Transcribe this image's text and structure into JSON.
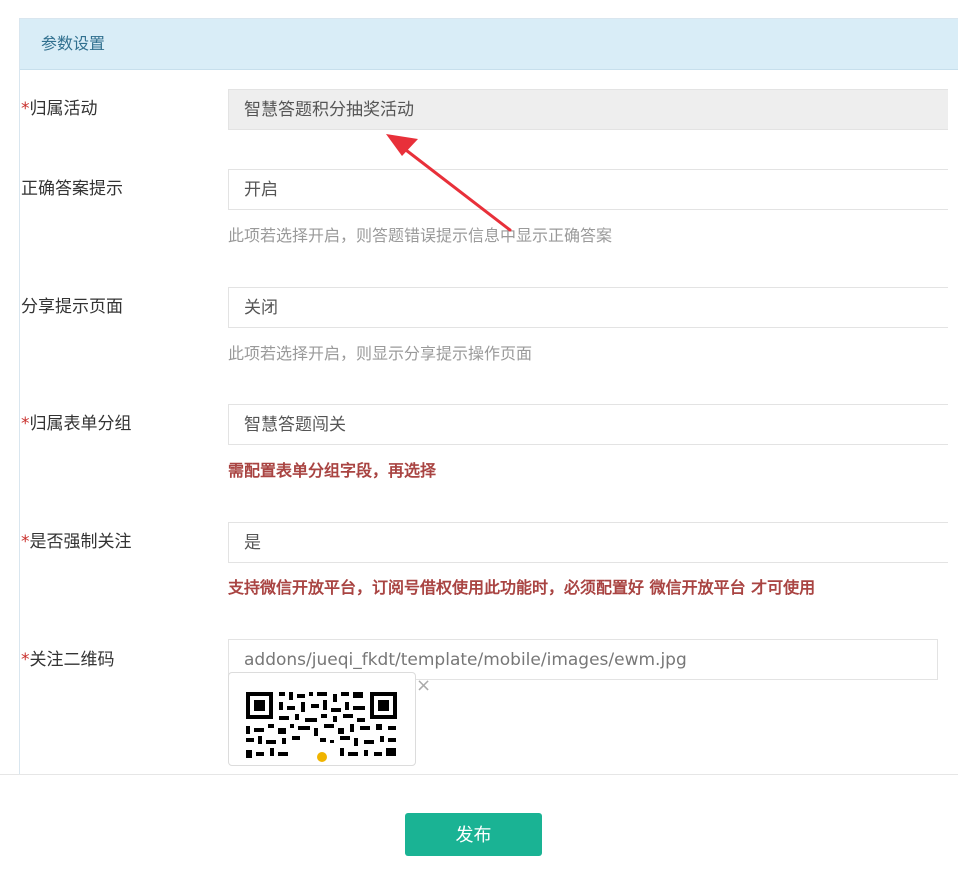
{
  "panel": {
    "heading": "参数设置"
  },
  "form": {
    "required_mark": "*",
    "activity": {
      "label": "归属活动",
      "value": "智慧答题积分抽奖活动"
    },
    "show_answer": {
      "label": "正确答案提示",
      "value": "开启",
      "help": "此项若选择开启，则答题错误提示信息中显示正确答案"
    },
    "share_page": {
      "label": "分享提示页面",
      "value": "关闭",
      "help": "此项若选择开启，则显示分享提示操作页面"
    },
    "form_group": {
      "label": "归属表单分组",
      "value": "智慧答题闯关",
      "warning": "需配置表单分组字段，再选择"
    },
    "force_follow": {
      "label": "是否强制关注",
      "value": "是",
      "warning": "支持微信开放平台，订阅号借权使用此功能时，必须配置好 微信开放平台 才可使用"
    },
    "qrcode": {
      "label": "关注二维码",
      "value": "addons/jueqi_fkdt/template/mobile/images/ewm.jpg",
      "remove_label": "×"
    }
  },
  "actions": {
    "publish_label": "发布"
  },
  "colors": {
    "accent": "#1ab394",
    "required": "#c9302c",
    "warning": "#a94442",
    "annotation_arrow": "#e8303a"
  }
}
